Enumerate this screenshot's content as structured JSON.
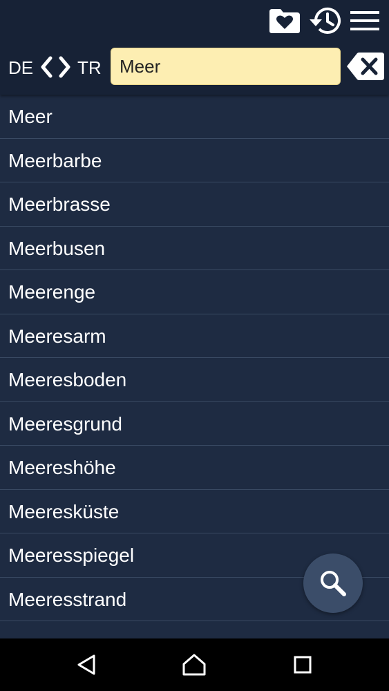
{
  "toolbar": {
    "favorites_icon": "folder-heart-icon",
    "history_icon": "history-icon",
    "menu_icon": "menu-icon"
  },
  "lang": {
    "source": "DE",
    "target": "TR"
  },
  "search": {
    "value": "Meer",
    "clear_icon": "backspace-clear-icon"
  },
  "results": [
    "Meer",
    "Meerbarbe",
    "Meerbrasse",
    "Meerbusen",
    "Meerenge",
    "Meeresarm",
    "Meeresboden",
    "Meeresgrund",
    "Meereshöhe",
    "Meeresküste",
    "Meeresspiegel",
    "Meeresstrand"
  ],
  "fab": {
    "icon": "search-icon"
  },
  "nav": {
    "back": "back-icon",
    "home": "home-icon",
    "recents": "recents-icon"
  },
  "colors": {
    "background": "#1e2b42",
    "header": "#172236",
    "search_field": "#fdeeb2",
    "divider": "#3a4a63"
  }
}
